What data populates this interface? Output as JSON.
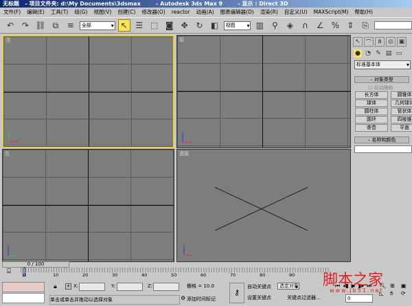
{
  "title": {
    "doc": "无标题",
    "project": "- 项目文件夹: d:\\My Documents\\3dsmax",
    "app": "- Autodesk 3ds Max 9",
    "display": "- 显示 : Direct 3D"
  },
  "menu": [
    "文件(F)",
    "编辑(E)",
    "工具(T)",
    "组(G)",
    "视图(V)",
    "创建(C)",
    "修改器(O)",
    "reactor",
    "动画(A)",
    "图表编辑器(D)",
    "渲染(R)",
    "自定义(U)",
    "MAXScript(M)",
    "帮助(H)"
  ],
  "toolbar": {
    "selection_filter": "全部",
    "ref_coord": "视图"
  },
  "viewports": [
    {
      "label": "顶",
      "active": true
    },
    {
      "label": "前"
    },
    {
      "label": "左"
    },
    {
      "label": "透视"
    }
  ],
  "command_panel": {
    "category": "标准基本体",
    "object_type_title": "对象类型",
    "autogrid": "自动栅格",
    "buttons": [
      "长方体",
      "圆锥体",
      "球体",
      "几何球体",
      "圆柱体",
      "管状体",
      "圆环",
      "四棱锥",
      "茶壶",
      "平面"
    ],
    "name_color_title": "名称和颜色"
  },
  "timeline": {
    "frame": "0 / 100",
    "ticks": [
      "0",
      "10",
      "20",
      "30",
      "40",
      "50",
      "60",
      "70",
      "80",
      "90"
    ]
  },
  "status": {
    "x_label": "X:",
    "y_label": "Y:",
    "z_label": "Z:",
    "grid": "栅格 = 10.0",
    "prompt": "单击或单击并拖动以选择对象",
    "add_time_tag": "添加时间标记",
    "auto_key": "自动关键点",
    "set_key": "设置关键点",
    "key_mode": "选定对象",
    "key_filters": "关键点过滤器...",
    "current_frame": "0"
  },
  "watermark": {
    "logo": "脚本之家",
    "url": "www.jb51.net"
  },
  "colors": {
    "active_viewport": "#e8d040",
    "viewport_bg": "#7d7d7d",
    "title_bar": "#0a246a",
    "watermark": "#e02020"
  }
}
